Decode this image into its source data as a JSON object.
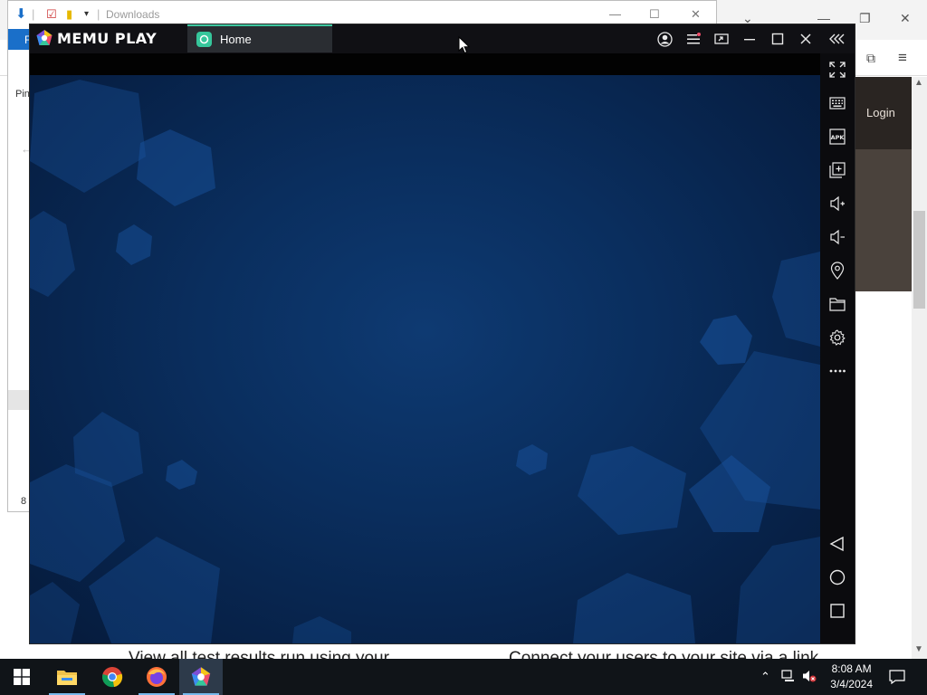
{
  "background_browser": {
    "login_label": "Login",
    "footer_left": "View all test results run using your",
    "footer_right": "Connect your users to your site via a link"
  },
  "explorer": {
    "title": "Downloads",
    "ribbon_tab": "F",
    "side_text": "Pin",
    "item_count": "8"
  },
  "memu": {
    "logo_text": "MEMU PLAY",
    "tab_label": "Home",
    "title_buttons": [
      "account-icon",
      "menu-icon",
      "screen-cast-icon",
      "minimize-icon",
      "maximize-icon",
      "close-icon",
      "collapse-sidebar-icon"
    ],
    "sidebar_buttons": [
      "fullscreen-icon",
      "keyboard-icon",
      "apk-icon",
      "multi-instance-icon",
      "volume-up-icon",
      "volume-down-icon",
      "location-icon",
      "folder-icon",
      "settings-icon",
      "more-icon"
    ],
    "nav_buttons": [
      "back-icon",
      "home-icon",
      "recents-icon"
    ],
    "apk_label": "APK"
  },
  "taskbar": {
    "time": "8:08 AM",
    "date": "3/4/2024",
    "apps": [
      "start-icon",
      "file-explorer-icon",
      "chrome-icon",
      "firefox-icon",
      "memu-icon"
    ]
  },
  "colors": {
    "memu_accent": "#3fc8a0",
    "screen_blue": "#0a2e5e",
    "taskbar": "#101418"
  }
}
